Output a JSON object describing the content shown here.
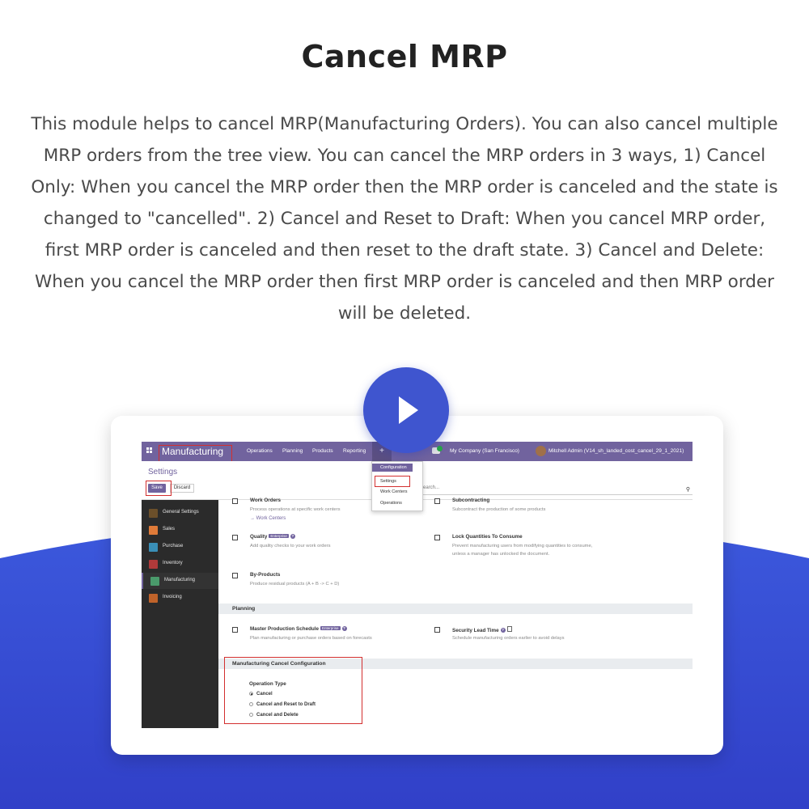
{
  "header": {
    "title": "Cancel MRP",
    "description": "This module helps to cancel MRP(Manufacturing Orders). You can also cancel multiple MRP orders from the tree view. You can cancel the MRP orders in 3 ways, 1) Cancel Only: When you cancel the MRP order then the MRP order is canceled and the state is changed to \"cancelled\". 2) Cancel and Reset to Draft:  When you cancel MRP order, first MRP order is canceled and then reset to the draft state. 3) Cancel and Delete: When you cancel the MRP order then first MRP order is canceled and then MRP order will be deleted."
  },
  "colors": {
    "accent": "#3f55cf",
    "odoo_purple": "#71639e",
    "highlight_red": "#d32f2f"
  },
  "screenshot": {
    "navbar": {
      "app_name": "Manufacturing",
      "menu": [
        "Operations",
        "Planning",
        "Products",
        "Reporting"
      ],
      "plus": "+",
      "company": "My Company (San Francisco)",
      "user": "Mitchell Admin (V14_sh_landed_cost_cancel_29_1_2021)"
    },
    "dropdown": {
      "header": "Configuration",
      "items": [
        "Settings",
        "Work Centers",
        "Operations"
      ]
    },
    "control": {
      "breadcrumb": "Settings",
      "save_label": "Save",
      "discard_label": "Discard",
      "search_placeholder": "earch..."
    },
    "sidebar": [
      {
        "label": "General Settings",
        "icon": "gear-icon",
        "color": "#6b4f2a"
      },
      {
        "label": "Sales",
        "icon": "sales-icon",
        "color": "#e07b39"
      },
      {
        "label": "Purchase",
        "icon": "purchase-icon",
        "color": "#3a8fb7"
      },
      {
        "label": "Inventory",
        "icon": "inventory-icon",
        "color": "#b03a3a"
      },
      {
        "label": "Manufacturing",
        "icon": "manufacturing-icon",
        "color": "#4a9a6b"
      },
      {
        "label": "Invoicing",
        "icon": "invoicing-icon",
        "color": "#c0632a"
      }
    ],
    "settings": {
      "work_orders": {
        "title": "Work Orders",
        "desc": "Process operations at specific work centers",
        "link": "Work Centers"
      },
      "subcontracting": {
        "title": "Subcontracting",
        "desc": "Subcontract the production of some products"
      },
      "quality": {
        "title": "Quality",
        "badge": "Enterprise",
        "desc": "Add quality checks to your work orders"
      },
      "lock_qty": {
        "title": "Lock Quantities To Consume",
        "desc1": "Prevent manufacturing users from modifying quantities to consume,",
        "desc2": "unless a manager has unlocked the document."
      },
      "byproducts": {
        "title": "By-Products",
        "desc": "Produce residual products (A + B -> C + D)"
      },
      "planning_header": "Planning",
      "mps": {
        "title": "Master Production Schedule",
        "badge": "Enterprise",
        "desc": "Plan manufacturing or purchase orders based on forecasts"
      },
      "security_lead": {
        "title": "Security Lead Time",
        "desc": "Schedule manufacturing orders earlier to avoid delays"
      },
      "cancel_config_header": "Manufacturing Cancel Configuration",
      "operation_type_label": "Operation Type",
      "operation_options": [
        "Cancel",
        "Cancel and Reset to Draft",
        "Cancel and Delete"
      ],
      "operation_selected": "Cancel"
    }
  }
}
